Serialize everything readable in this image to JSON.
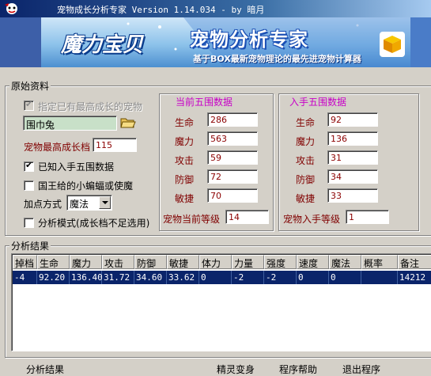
{
  "window": {
    "title": "宠物成长分析专家 Version 1.14.034 - by 暗月"
  },
  "banner": {
    "logo": "魔力宝贝",
    "title": "宠物分析专家",
    "subtitle": "基于BOX最新宠物理论的最先进宠物计算器"
  },
  "raw": {
    "group_title": "原始资料",
    "specify_max_label": "指定已有最高成长的宠物",
    "pet_name": "围巾兔",
    "max_growth_label": "宠物最高成长档",
    "max_growth_value": "115",
    "known_stats_label": "已知入手五围数据",
    "known_stats_checked": true,
    "king_bat_label": "国王给的小蝙蝠或使魔",
    "king_bat_checked": false,
    "bonus_mode_label": "加点方式",
    "bonus_mode_value": "魔法",
    "analysis_mode_label": "分析模式(成长档不足选用)",
    "analysis_mode_checked": false
  },
  "current": {
    "title": "当前五围数据",
    "rows": [
      {
        "label": "生命",
        "value": "286"
      },
      {
        "label": "魔力",
        "value": "563"
      },
      {
        "label": "攻击",
        "value": "59"
      },
      {
        "label": "防御",
        "value": "72"
      },
      {
        "label": "敏捷",
        "value": "70"
      }
    ],
    "level_label": "宠物当前等级",
    "level_value": "14"
  },
  "initial": {
    "title": "入手五围数据",
    "rows": [
      {
        "label": "生命",
        "value": "92"
      },
      {
        "label": "魔力",
        "value": "136"
      },
      {
        "label": "攻击",
        "value": "31"
      },
      {
        "label": "防御",
        "value": "34"
      },
      {
        "label": "敏捷",
        "value": "33"
      }
    ],
    "level_label": "宠物入手等级",
    "level_value": "1"
  },
  "result": {
    "group_title": "分析结果",
    "columns": [
      "掉档",
      "生命",
      "魔力",
      "攻击",
      "防御",
      "敏捷",
      "体力",
      "力量",
      "强度",
      "速度",
      "魔法",
      "概率",
      "备注"
    ],
    "rows": [
      [
        "-4",
        "92.20",
        "136.40",
        "31.72",
        "34.60",
        "33.62",
        "0",
        "-2",
        "-2",
        "0",
        "0",
        "",
        "14212"
      ]
    ]
  },
  "menu": {
    "items": [
      "分析结果",
      "精灵变身",
      "程序帮助",
      "退出程序"
    ]
  },
  "colors": {
    "face": "#d4d0c8",
    "selection": "#0a246a",
    "group_title_magenta": "#c800c8",
    "value_text": "#8b0000"
  }
}
